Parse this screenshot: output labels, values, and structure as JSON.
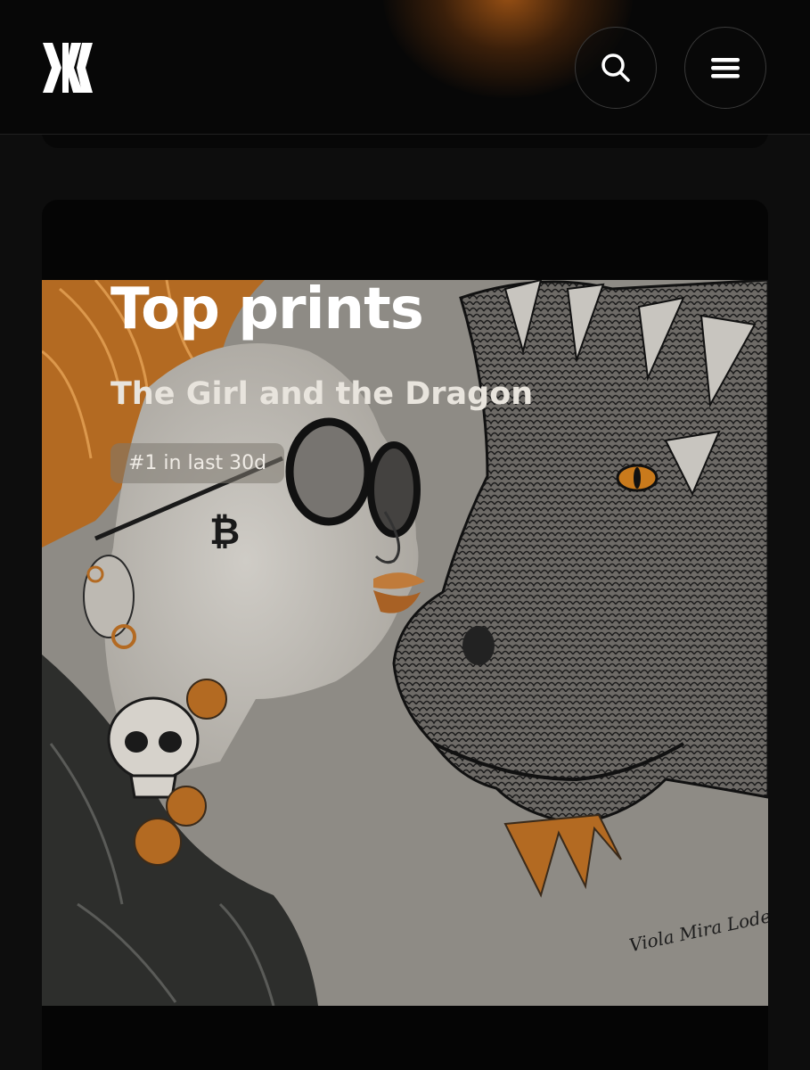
{
  "header": {
    "logo_icon": "brand-logo-icon",
    "search_icon": "search-icon",
    "menu_icon": "hamburger-menu-icon",
    "accent_color": "#b05c16"
  },
  "top_prints": {
    "title": "Top prints",
    "artwork_title": "The Girl and the Dragon",
    "rank_label": "#1 in last 30d",
    "artwork_signature": "Viola Mira Loden"
  }
}
